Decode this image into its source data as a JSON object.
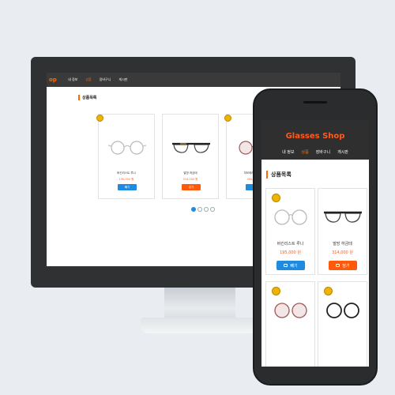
{
  "desktop": {
    "logo": "op",
    "nav": [
      "내 정보",
      "상품",
      "장바구니",
      "게시판"
    ],
    "active_nav": 1,
    "section_title": "상품목록",
    "products": [
      {
        "name": "버킨리스트 루나",
        "price": "195,000 원",
        "button": "빼기",
        "color": "blue"
      },
      {
        "name": "발망 하금테",
        "price": "314,000 원",
        "button": "담기",
        "color": "orange"
      },
      {
        "name": "미모테라토 해업대",
        "price": "492,000 원",
        "button": "빼기",
        "color": "blue"
      }
    ],
    "pagination_dots": 4,
    "active_dot": 0
  },
  "mobile": {
    "logo": "Glasses Shop",
    "nav": [
      "내 정보",
      "상품",
      "장바구니",
      "게시판"
    ],
    "active_nav": 1,
    "section_title": "상품목록",
    "products": [
      {
        "name": "버킨리스트 루나",
        "price": "195,000 원",
        "button": "빼기",
        "color": "blue"
      },
      {
        "name": "발망 하금테",
        "price": "314,000 원",
        "button": "담기",
        "color": "orange"
      }
    ]
  },
  "colors": {
    "accent": "#ff5a1f",
    "blue": "#1f8be0",
    "dark_header": "#2f2f2f"
  }
}
